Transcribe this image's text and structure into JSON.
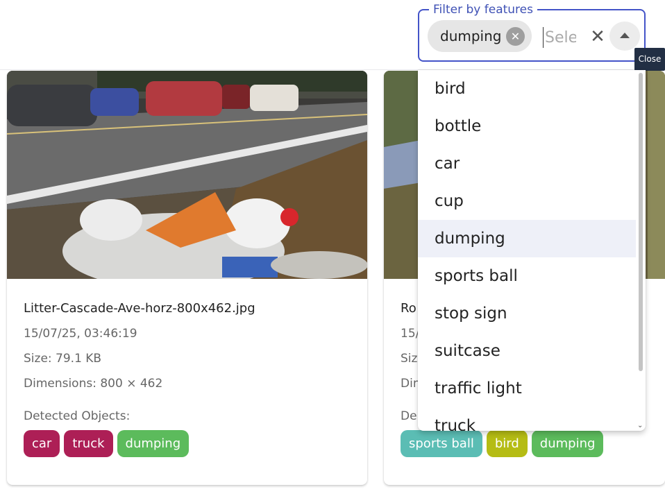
{
  "filter": {
    "legend": "Filter by features",
    "selected_chip": "dumping",
    "chip_delete_symbol": "✕",
    "input_placeholder": "Select",
    "clear_symbol": "✕",
    "popup_tooltip": "Close"
  },
  "options": [
    "bird",
    "bottle",
    "car",
    "cup",
    "dumping",
    "sports ball",
    "stop sign",
    "suitcase",
    "traffic light",
    "truck"
  ],
  "highlighted_option": "dumping",
  "cards": [
    {
      "filename": "Litter-Cascade-Ave-horz-800x462.jpg",
      "timestamp": "15/07/25, 03:46:19",
      "size": "Size: 79.1 KB",
      "dimensions": "Dimensions: 800 × 462",
      "detected_label": "Detected Objects:",
      "tags": [
        {
          "label": "car",
          "color": "#ad1f56"
        },
        {
          "label": "truck",
          "color": "#ad1f56"
        },
        {
          "label": "dumping",
          "color": "#5cbb5c"
        }
      ]
    },
    {
      "filename": "Ro",
      "timestamp": "15/",
      "size": "Siz",
      "dimensions": "Dim",
      "detected_label": "De",
      "tags": [
        {
          "label": "sports ball",
          "color": "#5bbdb4"
        },
        {
          "label": "bird",
          "color": "#b5bc14"
        },
        {
          "label": "dumping",
          "color": "#5cbb5c"
        }
      ]
    }
  ],
  "colors": {
    "accent": "#3f51b5",
    "tooltip_bg": "#222f44",
    "highlight_bg": "#eef0f8"
  }
}
